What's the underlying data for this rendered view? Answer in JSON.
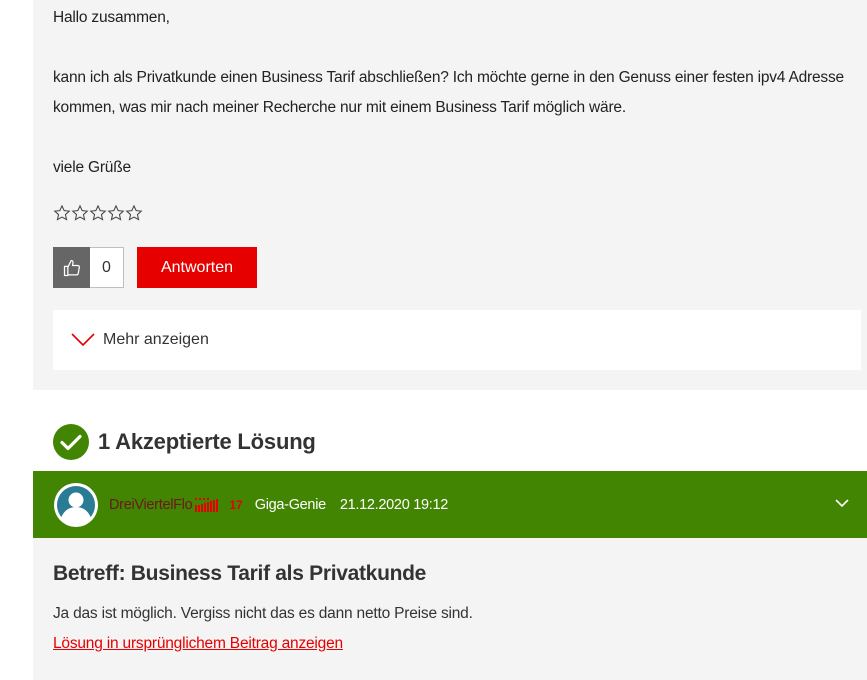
{
  "post": {
    "greeting": "Hallo zusammen,",
    "body": "kann ich als Privatkunde einen Business Tarif abschließen? Ich möchte gerne in den Genuss einer festen ipv4 Adresse kommen, was mir nach meiner Recherche nur mit einem Business Tarif möglich wäre.",
    "sign_off": "viele Grüße",
    "rating_stars": 5,
    "rating_value": 0,
    "kudos_count": "0",
    "reply_label": "Antworten",
    "more_label": "Mehr anzeigen"
  },
  "solution": {
    "header": "1 Akzeptierte Lösung",
    "author_name": "DreiViertelFlo",
    "author_rank_number": "17",
    "author_rank_title": "Giga-Genie",
    "date": "21.12.2020 19:12",
    "subject": "Betreff: Business Tarif als Privatkunde",
    "text": "Ja das ist möglich. Vergiss nicht das es dann netto Preise sind.",
    "link_label": "Lösung in ursprünglichem Beitrag anzeigen"
  },
  "colors": {
    "accent_red": "#e60000",
    "solution_green": "#428503",
    "card_background": "#f4f4f4"
  },
  "icons": {
    "kudos": "thumbs-up-icon",
    "more": "chevron-down-icon",
    "solution": "check-circle-icon",
    "avatar": "user-avatar-icon",
    "rank": "rank-bars-icon",
    "collapse": "chevron-down-icon"
  }
}
